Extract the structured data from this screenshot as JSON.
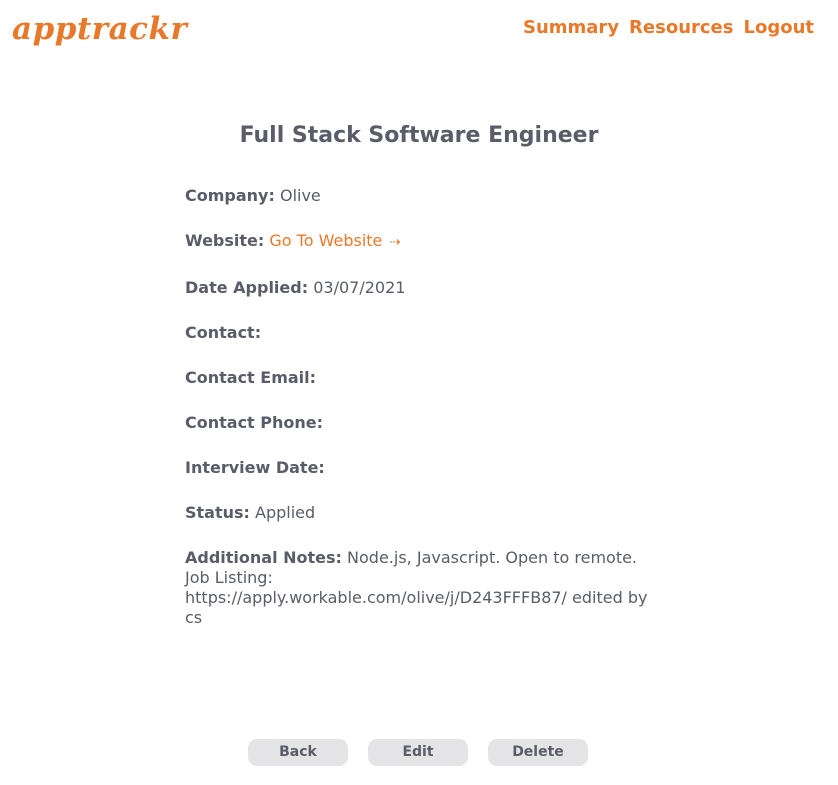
{
  "header": {
    "logo": "apptrackr",
    "nav": [
      "Summary",
      "Resources",
      "Logout"
    ]
  },
  "job": {
    "title": "Full Stack Software Engineer",
    "company_label": "Company:",
    "company": "Olive",
    "website_label": "Website:",
    "website_link": "Go To Website",
    "website_arrow": "⇢",
    "date_applied_label": "Date Applied:",
    "date_applied": "03/07/2021",
    "contact_label": "Contact:",
    "contact": "",
    "contact_email_label": "Contact Email:",
    "contact_email": "",
    "contact_phone_label": "Contact Phone:",
    "contact_phone": "",
    "interview_date_label": "Interview Date:",
    "interview_date": "",
    "status_label": "Status:",
    "status": "Applied",
    "notes_label": "Additional Notes:",
    "notes": "Node.js, Javascript. Open to remote. Job Listing: https://apply.workable.com/olive/j/D243FFFB87/ edited by cs"
  },
  "actions": {
    "back": "Back",
    "edit": "Edit",
    "delete": "Delete"
  },
  "colors": {
    "accent": "#e8792a",
    "text": "#5a5d68",
    "button_bg": "#e4e4e6"
  }
}
